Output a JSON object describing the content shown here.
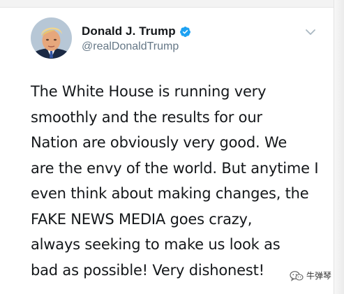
{
  "tweet": {
    "display_name": "Donald J. Trump",
    "handle": "@realDonaldTrump",
    "verified": true,
    "avatar_icon": "profile-photo",
    "more_icon": "chevron-down-icon",
    "lines": [
      "The White House is running very",
      "smoothly and the results for our",
      "Nation are obviously very good. We",
      "are the envy of the world. But anytime I",
      "even think about making changes, the",
      "FAKE NEWS MEDIA goes crazy,",
      "always seeking to make us look as",
      "bad as possible! Very dishonest!"
    ]
  },
  "watermark": {
    "text": "牛弹琴",
    "icon": "wechat-logo"
  },
  "colors": {
    "verified_blue": "#1da1f2",
    "text": "#14171a",
    "muted": "#657786"
  }
}
